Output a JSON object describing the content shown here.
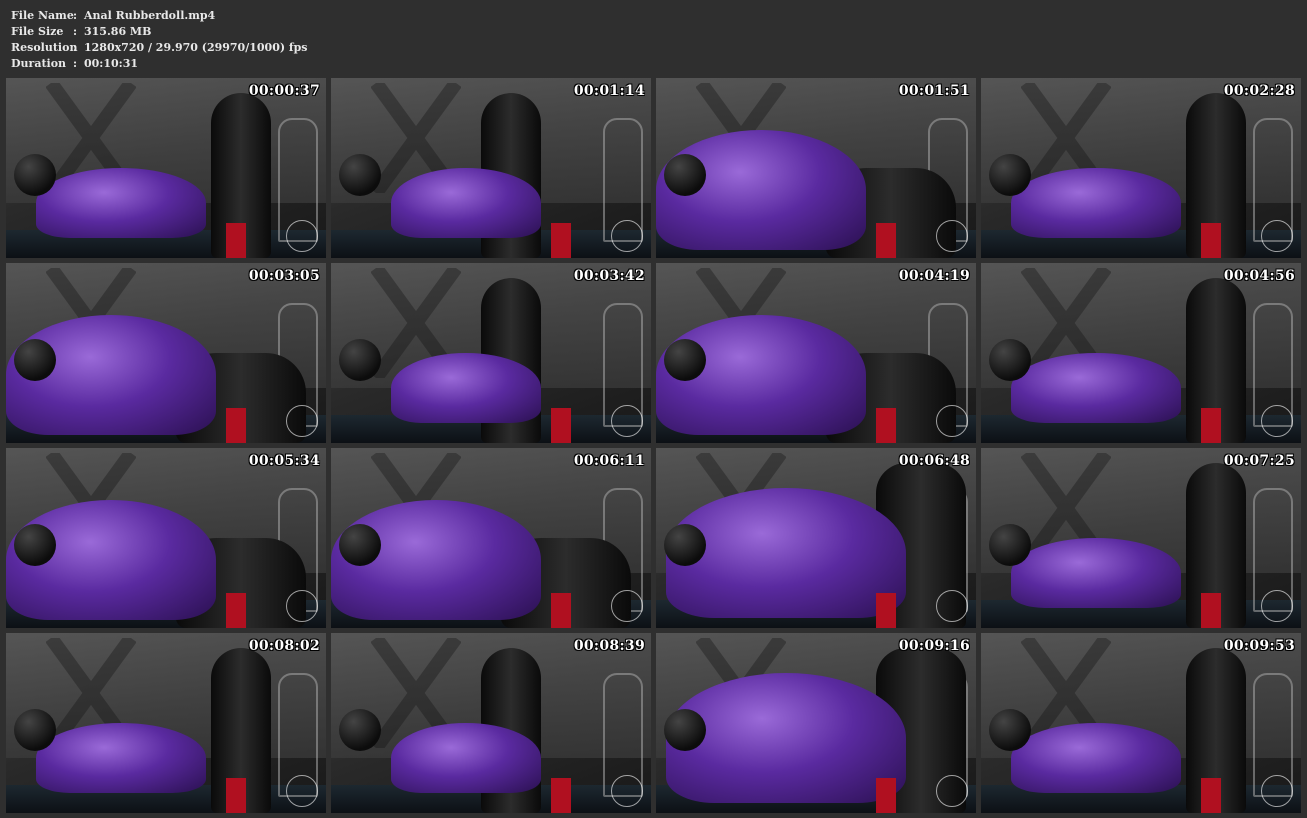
{
  "info": {
    "file_name": {
      "label": "File Name",
      "sep": ":",
      "value": "Anal Rubberdoll.mp4"
    },
    "file_size": {
      "label": "File Size",
      "sep": ":",
      "value": "315.86 MB"
    },
    "resolution": {
      "label": "Resolution",
      "sep": ":",
      "value": "1280x720 / 29.970 (29970/1000) fps"
    },
    "duration": {
      "label": "Duration",
      "sep": ":",
      "value": "00:10:31"
    }
  },
  "colors": {
    "background": "#2f2f2f",
    "text": "#e8e8e8",
    "timestamp": "#ffffff",
    "latex_purple": "#5a2aa0",
    "accent_red": "#b01020"
  },
  "thumbnails": [
    {
      "timestamp": "00:00:37"
    },
    {
      "timestamp": "00:01:14"
    },
    {
      "timestamp": "00:01:51"
    },
    {
      "timestamp": "00:02:28"
    },
    {
      "timestamp": "00:03:05"
    },
    {
      "timestamp": "00:03:42"
    },
    {
      "timestamp": "00:04:19"
    },
    {
      "timestamp": "00:04:56"
    },
    {
      "timestamp": "00:05:34"
    },
    {
      "timestamp": "00:06:11"
    },
    {
      "timestamp": "00:06:48"
    },
    {
      "timestamp": "00:07:25"
    },
    {
      "timestamp": "00:08:02"
    },
    {
      "timestamp": "00:08:39"
    },
    {
      "timestamp": "00:09:16"
    },
    {
      "timestamp": "00:09:53"
    }
  ]
}
